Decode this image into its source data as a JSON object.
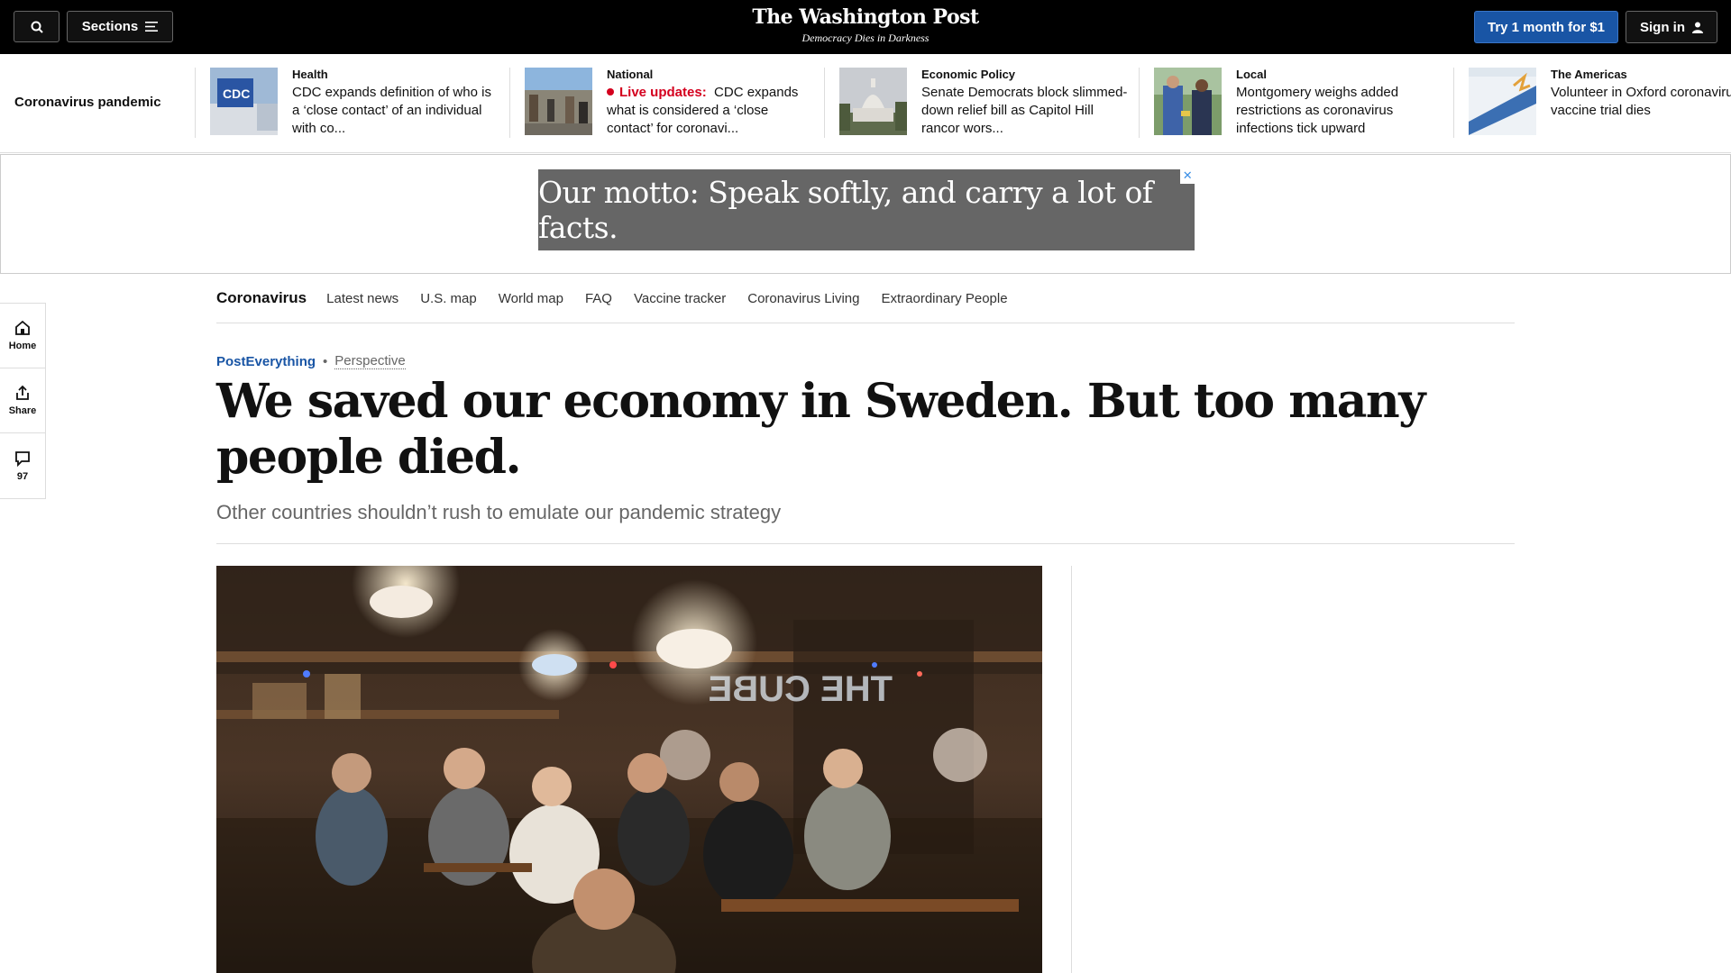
{
  "header": {
    "sections_label": "Sections",
    "logo_name": "The Washington Post",
    "logo_tagline": "Democracy Dies in Darkness",
    "try_label": "Try 1 month for $1",
    "signin_label": "Sign in"
  },
  "rail": {
    "title": "Coronavirus pandemic",
    "items": [
      {
        "kicker": "Health",
        "headline": "CDC expands definition of who is a ‘close contact’ of an individual with co..."
      },
      {
        "kicker": "National",
        "live": "Live updates:",
        "headline": "CDC expands what is considered a ‘close contact’ for coronavi..."
      },
      {
        "kicker": "Economic Policy",
        "headline": "Senate Democrats block slimmed-down relief bill as Capitol Hill rancor wors..."
      },
      {
        "kicker": "Local",
        "headline": "Montgomery weighs added restrictions as coronavirus infections tick upward"
      },
      {
        "kicker": "The Americas",
        "headline": "Volunteer in Oxford coronavirus vaccine trial dies"
      }
    ]
  },
  "ad": {
    "text": "Our motto: Speak softly, and carry a lot of facts."
  },
  "subnav": {
    "brand": "Coronavirus",
    "links": [
      "Latest news",
      "U.S. map",
      "World map",
      "FAQ",
      "Vaccine tracker",
      "Coronavirus Living",
      "Extraordinary People"
    ]
  },
  "siderail": {
    "home": "Home",
    "share": "Share",
    "comments": "97"
  },
  "article": {
    "section": "PostEverything",
    "label": "Perspective",
    "title": "We saved our economy in Sweden. But too many people died.",
    "subtitle": "Other countries shouldn’t rush to emulate our pandemic strategy"
  }
}
